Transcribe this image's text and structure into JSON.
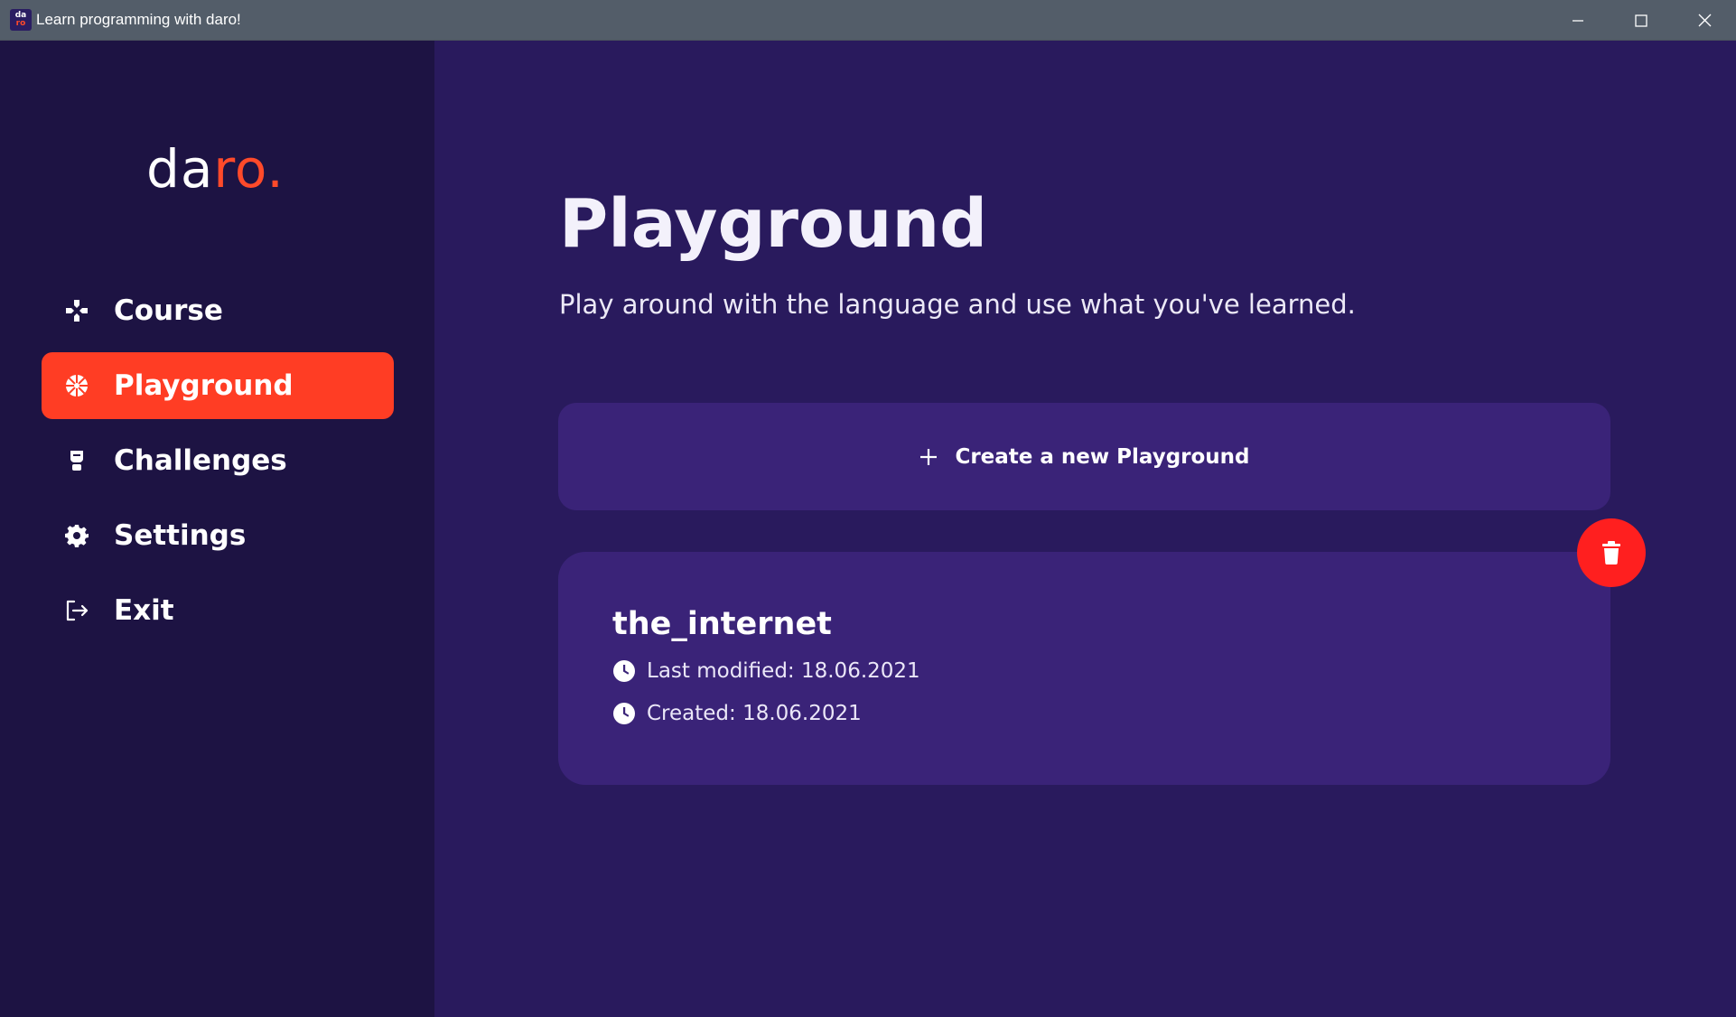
{
  "window": {
    "title": "Learn programming with daro!",
    "icon_text_top": "da",
    "icon_text_bottom": "ro",
    "controls": [
      "minimize-icon",
      "maximize-icon",
      "close-icon"
    ]
  },
  "sidebar": {
    "logo_part1": "da",
    "logo_part2": "ro.",
    "items": [
      {
        "label": "Course",
        "icon": "gamepad-icon",
        "active": false
      },
      {
        "label": "Playground",
        "icon": "basketball-icon",
        "active": true
      },
      {
        "label": "Challenges",
        "icon": "trophy-icon",
        "active": false
      },
      {
        "label": "Settings",
        "icon": "gear-icon",
        "active": false
      },
      {
        "label": "Exit",
        "icon": "exit-icon",
        "active": false
      }
    ]
  },
  "main": {
    "title": "Playground",
    "subtitle": "Play around with the language and use what you've learned.",
    "create_label": "Create a new Playground",
    "playgrounds": [
      {
        "name": "the_internet",
        "last_modified": "Last modified: 18.06.2021",
        "created": "Created: 18.06.2021"
      }
    ]
  },
  "colors": {
    "sidebar_bg": "#1d1343",
    "main_bg": "#291a5d",
    "card_bg": "#3a2378",
    "accent": "#ff3d24",
    "delete": "#ff1f1f",
    "titlebar": "#535d69"
  }
}
